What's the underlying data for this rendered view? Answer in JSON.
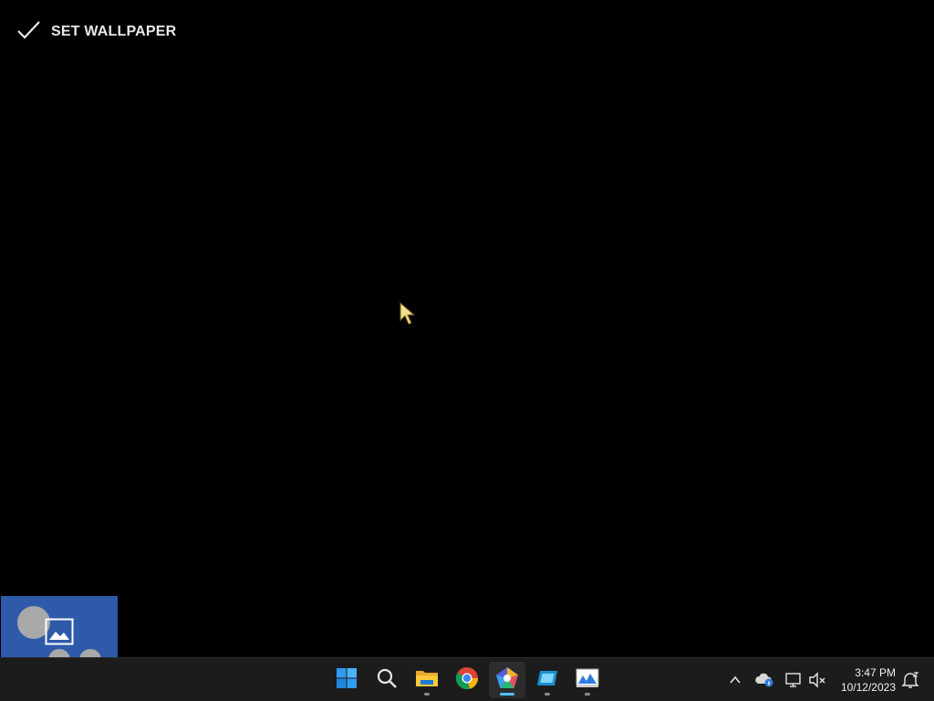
{
  "viewer": {
    "set_wallpaper_label": "SET WALLPAPER",
    "set_wallpaper_icon": "checkmark-icon",
    "thumbnail_icon": "image-icon"
  },
  "taskbar": {
    "apps": [
      {
        "name": "start-icon",
        "indicator": false,
        "active": false
      },
      {
        "name": "search-icon",
        "indicator": false,
        "active": false
      },
      {
        "name": "file-explorer-icon",
        "indicator": true,
        "active": false
      },
      {
        "name": "chrome-icon",
        "indicator": false,
        "active": false
      },
      {
        "name": "photo-app-icon",
        "indicator": true,
        "active": true
      },
      {
        "name": "app-icon",
        "indicator": true,
        "active": false
      },
      {
        "name": "image-viewer-icon",
        "indicator": true,
        "active": false
      }
    ],
    "tray": [
      "chevron-up-icon",
      "onedrive-icon",
      "network-icon",
      "volume-muted-icon",
      "notifications-icon"
    ],
    "clock": {
      "time": "3:47 PM",
      "date": "10/12/2023"
    }
  },
  "colors": {
    "taskbar_bg": "#1c1c1c",
    "accent": "#4cc2ff",
    "thumbnail_bg": "#2e5aa9"
  }
}
